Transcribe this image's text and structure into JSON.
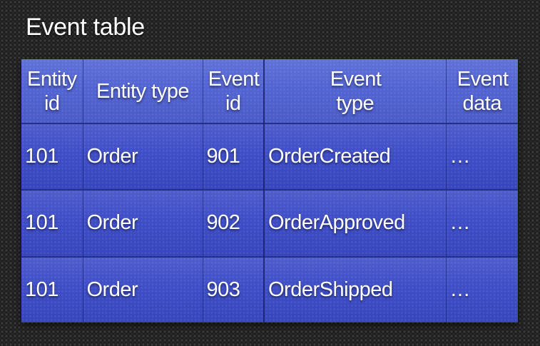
{
  "slide": {
    "title": "Event table"
  },
  "table": {
    "headers": {
      "entity_id": "Entity id",
      "entity_type": "Entity type",
      "event_id": "Event id",
      "event_type": "Event type",
      "event_data": "Event data"
    },
    "rows": [
      {
        "entity_id": "101",
        "entity_type": "Order",
        "event_id": "901",
        "event_type": "OrderCreated",
        "event_data": "…"
      },
      {
        "entity_id": "101",
        "entity_type": "Order",
        "event_id": "902",
        "event_type": "OrderApproved",
        "event_data": "…"
      },
      {
        "entity_id": "101",
        "entity_type": "Order",
        "event_id": "903",
        "event_type": "OrderShipped",
        "event_data": "…"
      }
    ]
  },
  "colors": {
    "table_blue": "#3b4ac6",
    "header_blue": "#4f61d2",
    "background": "#1c1c1c",
    "text": "#ffffff"
  }
}
